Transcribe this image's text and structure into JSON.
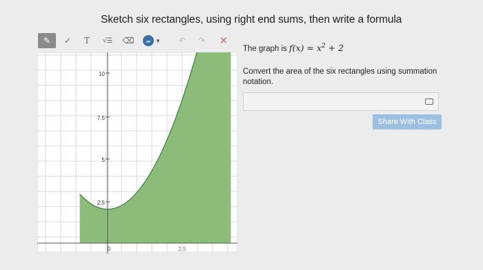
{
  "header": {
    "title": "Sketch six rectangles, using right end sums, then write a formula"
  },
  "toolbar": {
    "tools": [
      {
        "name": "pencil-icon",
        "glyph": "✎"
      },
      {
        "name": "checkmark-icon",
        "glyph": "✓"
      },
      {
        "name": "text-tool-icon",
        "glyph": "T"
      },
      {
        "name": "sqrt-tool-icon",
        "glyph": "√☰"
      },
      {
        "name": "eraser-icon",
        "glyph": "⌫"
      },
      {
        "name": "graph-function-icon",
        "glyph": "𝓌"
      },
      {
        "name": "undo-icon",
        "glyph": "↶"
      },
      {
        "name": "redo-icon",
        "glyph": "↷"
      },
      {
        "name": "clear-icon",
        "glyph": "✕"
      }
    ]
  },
  "graph": {
    "y_ticks": [
      "10",
      "7.5",
      "5",
      "2.5"
    ],
    "x_ticks": [
      "0",
      "2.5"
    ],
    "fill_color": "#8dbb7a",
    "stroke_color": "#3c8a3c",
    "background_color": "#ffffff",
    "grid_color": "#d9d9d9"
  },
  "panel": {
    "fn_prefix": "The graph is ",
    "fn_lhs": "f(x) = x",
    "fn_exp": "2",
    "fn_rhs": " + 2",
    "prompt": "Convert the area of the six rectangles using summation notation.",
    "share_label": "Share With Class"
  }
}
